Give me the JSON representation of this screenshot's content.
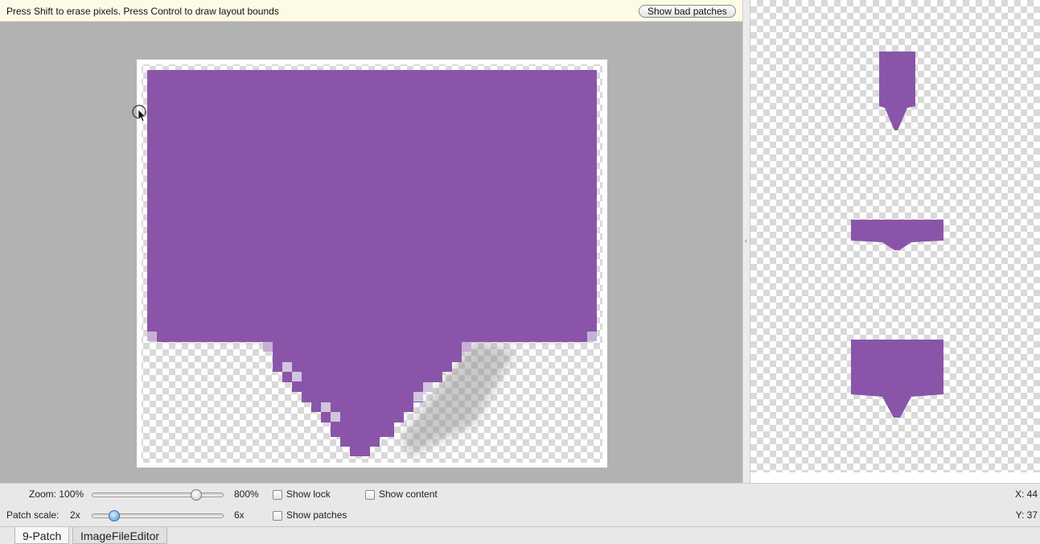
{
  "hint": {
    "message": "Press Shift to erase pixels. Press Control to draw layout bounds",
    "bad_patches_label": "Show bad patches"
  },
  "colors": {
    "patch_fill": "#8a55a9",
    "canvas_bg": "#b2b2b2"
  },
  "controls": {
    "zoom_label": "Zoom: 100%",
    "zoom_max": "800%",
    "zoom_level": 0.8,
    "patch_scale_label": "Patch scale:",
    "patch_scale_min": "2x",
    "patch_scale_max": "6x",
    "patch_scale_level": 0.17,
    "show_lock": "Show lock",
    "show_content": "Show content",
    "show_patches": "Show patches",
    "x_readout": "X: 44",
    "y_readout": "Y: 37"
  },
  "tabs": [
    {
      "label": "9-Patch",
      "active": true
    },
    {
      "label": "ImageFileEditor",
      "active": false
    }
  ],
  "icons": {
    "cursor": "arrow-cursor-icon",
    "grip": "splitter-grip-icon"
  }
}
